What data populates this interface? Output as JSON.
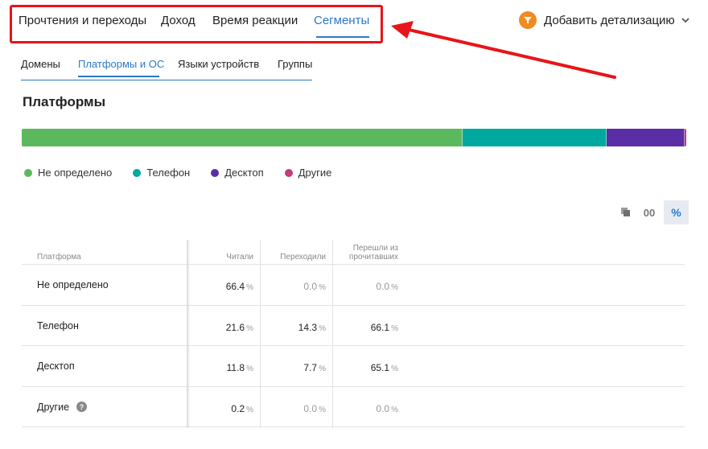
{
  "top_tabs": [
    {
      "label": "Прочтения и переходы"
    },
    {
      "label": "Доход"
    },
    {
      "label": "Время реакции"
    },
    {
      "label": "Сегменты",
      "active": true
    }
  ],
  "detail_button": {
    "label": "Добавить детализацию",
    "icon": "funnel-icon"
  },
  "sub_tabs": [
    {
      "label": "Домены"
    },
    {
      "label": "Платформы и ОС",
      "active": true
    },
    {
      "label": "Языки устройств"
    },
    {
      "label": "Группы"
    }
  ],
  "section_title": "Платформы",
  "distribution": [
    {
      "name": "Не определено",
      "share": 66.4,
      "color": "#5cb85c"
    },
    {
      "name": "Телефон",
      "share": 21.6,
      "color": "#00a99d"
    },
    {
      "name": "Десктоп",
      "share": 11.8,
      "color": "#5a2ea6"
    },
    {
      "name": "Другие",
      "share": 0.2,
      "color": "#c23b7a"
    }
  ],
  "legend": [
    {
      "label": "Не определено",
      "color": "#5cb85c"
    },
    {
      "label": "Телефон",
      "color": "#00a99d"
    },
    {
      "label": "Десктоп",
      "color": "#5a2ea6"
    },
    {
      "label": "Другие",
      "color": "#c23b7a"
    }
  ],
  "view_toggle": {
    "copy_icon": "copy-icon",
    "absolute_label": "00",
    "percent_label": "%",
    "active": "percent"
  },
  "table": {
    "headers": {
      "platform": "Платформа",
      "read": "Читали",
      "clicked": "Переходили",
      "clicked_of_read_line1": "Перешли из",
      "clicked_of_read_line2": "прочитавших"
    },
    "unit": "%",
    "rows": [
      {
        "name": "Не определено",
        "read": "66.4",
        "clicked": "0.0",
        "clicked_of_read": "0.0",
        "clicked_muted": true,
        "ratio_muted": true
      },
      {
        "name": "Телефон",
        "read": "21.6",
        "clicked": "14.3",
        "clicked_of_read": "66.1",
        "clicked_muted": false,
        "ratio_muted": false
      },
      {
        "name": "Десктоп",
        "read": "11.8",
        "clicked": "7.7",
        "clicked_of_read": "65.1",
        "clicked_muted": false,
        "ratio_muted": false
      },
      {
        "name": "Другие",
        "read": "0.2",
        "clicked": "0.0",
        "clicked_of_read": "0.0",
        "clicked_muted": true,
        "ratio_muted": true,
        "help_icon": "question-icon"
      }
    ]
  }
}
